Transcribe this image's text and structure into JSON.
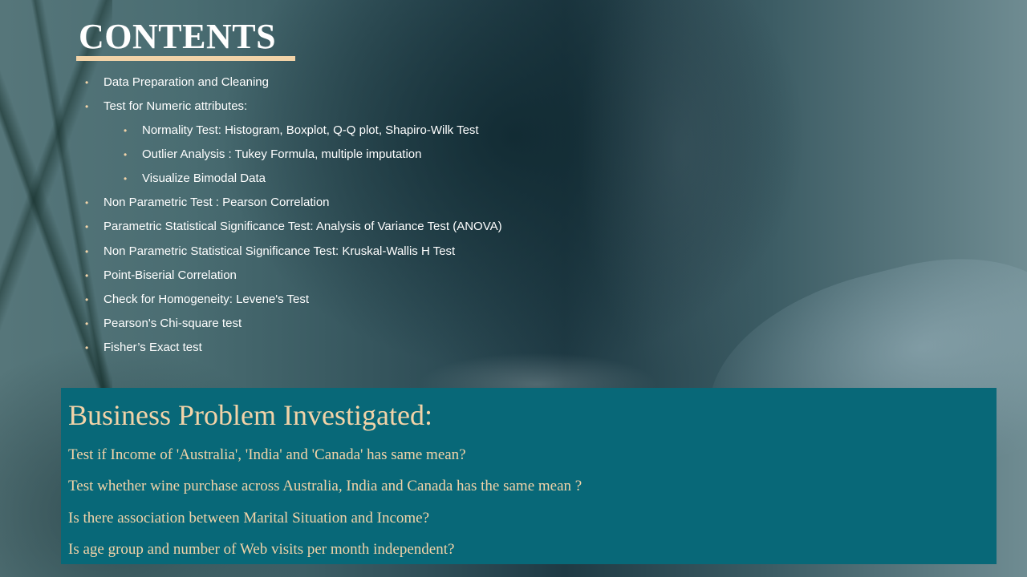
{
  "slide": {
    "title": "CONTENTS",
    "contents": [
      {
        "level": 1,
        "text": "Data Preparation and Cleaning"
      },
      {
        "level": 1,
        "text": "Test for Numeric attributes:"
      },
      {
        "level": 2,
        "text": "Normality Test:  Histogram, Boxplot,  Q-Q plot,   Shapiro-Wilk Test"
      },
      {
        "level": 2,
        "text": "Outlier Analysis : Tukey Formula, multiple imputation"
      },
      {
        "level": 2,
        "text": "Visualize Bimodal Data"
      },
      {
        "level": 1,
        "text": "Non Parametric Test : Pearson Correlation"
      },
      {
        "level": 1,
        "text": "Parametric Statistical Significance Test:  Analysis of Variance Test (ANOVA)"
      },
      {
        "level": 1,
        "text": "Non Parametric Statistical Significance Test:   Kruskal-Wallis H Test"
      },
      {
        "level": 1,
        "text": "Point-Biserial Correlation"
      },
      {
        "level": 1,
        "text": "Check for Homogeneity:   Levene's Test"
      },
      {
        "level": 1,
        "text": "Pearson's Chi-square test"
      },
      {
        "level": 1,
        "text": "Fisher’s Exact test"
      }
    ],
    "bullet": "•",
    "business_problem": {
      "heading": "Business Problem Investigated:",
      "questions": [
        "Test if Income of 'Australia',  'India' and 'Canada' has same mean?",
        "Test whether wine purchase across Australia,  India and Canada  has the same mean ?",
        "Is there association between Marital Situation and Income?",
        "Is age group and number of Web visits per month independent?"
      ]
    },
    "colors": {
      "accent": "#f2d3a8",
      "panel": "#086878",
      "text": "#ffffff"
    }
  }
}
